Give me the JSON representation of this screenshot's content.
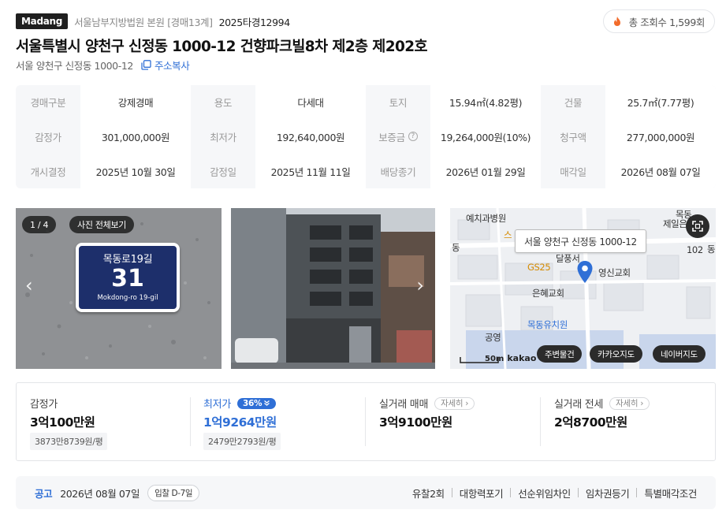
{
  "header": {
    "brand": "Madang",
    "court": "서울남부지방법원 본원 [경매13계]",
    "case_no": "2025타경12994",
    "views": "총 조회수 1,599회"
  },
  "title": "서울특별시 양천구 신정동 1000-12 건향파크빌8차 제2층 제202호",
  "address": "서울 양천구 신정동 1000-12",
  "copy_label": "주소복사",
  "info": {
    "row1": [
      {
        "k": "경매구분",
        "v": "강제경매"
      },
      {
        "k": "용도",
        "v": "다세대"
      },
      {
        "k": "토지",
        "v": "15.94㎡(4.82평)"
      },
      {
        "k": "건물",
        "v": "25.7㎡(7.77평)"
      }
    ],
    "row2": [
      {
        "k": "감정가",
        "v": "301,000,000원"
      },
      {
        "k": "최저가",
        "v": "192,640,000원"
      },
      {
        "k": "보증금",
        "v": "19,264,000원(10%)"
      },
      {
        "k": "청구액",
        "v": "277,000,000원"
      }
    ],
    "row3": [
      {
        "k": "개시결정",
        "v": "2025년 10월 30일"
      },
      {
        "k": "감정일",
        "v": "2025년 11월 11일"
      },
      {
        "k": "배당종기",
        "v": "2026년 01월 29일"
      },
      {
        "k": "매각일",
        "v": "2026년 08월 07일"
      }
    ]
  },
  "photos": {
    "counter": "1 / 4",
    "view_all": "사진 전체보기",
    "sign_top": "목동로19길",
    "sign_number": "31",
    "sign_bottom": "Mokdong-ro 19-gil"
  },
  "map": {
    "bubble": "서울 양천구 신정동 1000-12",
    "labels": [
      "예치과병원",
      "스",
      "동",
      "달풍서",
      "GS25",
      "영신교회",
      "은혜교회",
      "목동유치원",
      "공영",
      "목동",
      "제일은",
      "102",
      "동"
    ],
    "scale": "50m",
    "provider": "kakao",
    "buttons": [
      "주변물건",
      "카카오지도",
      "네이버지도"
    ]
  },
  "prices": [
    {
      "label": "감정가",
      "value": "3억100만원",
      "sub": "3873만8739원/평"
    },
    {
      "label": "최저가",
      "badge": "36%",
      "value": "1억9264만원",
      "sub": "2479만2793원/평"
    },
    {
      "label": "실거래 매매",
      "detail": "자세히",
      "value": "3억9100만원"
    },
    {
      "label": "실거래 전세",
      "detail": "자세히",
      "value": "2억8700만원"
    }
  ],
  "bottom": {
    "notice": "공고",
    "date": "2026년 08월 07일",
    "dday": "입찰 D-7일",
    "tags": [
      "유찰2회",
      "대항력포기",
      "선순위임차인",
      "임차권등기",
      "특별매각조건"
    ]
  },
  "colors": {
    "accent": "#2f6fd6",
    "flame": "#f26b2a",
    "brand_bg": "#1f1f1f"
  }
}
